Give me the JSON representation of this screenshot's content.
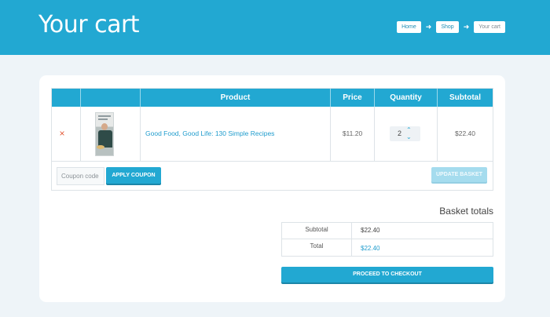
{
  "header": {
    "title": "Your cart",
    "breadcrumb": [
      "Home",
      "Shop",
      "Your cart"
    ]
  },
  "cart": {
    "columns": [
      "",
      "",
      "Product",
      "Price",
      "Quantity",
      "Subtotal"
    ],
    "items": [
      {
        "remove_icon": "close-icon",
        "remove_symbol": "×",
        "product": "Good Food, Good Life: 130 Simple Recipes",
        "price": "$11.20",
        "quantity": "2",
        "subtotal": "$22.40"
      }
    ],
    "quantity_up": "⌃",
    "quantity_down": "⌄",
    "coupon_placeholder": "Coupon code",
    "apply_coupon": "Apply coupon",
    "update_basket": "Update basket"
  },
  "totals": {
    "title": "Basket totals",
    "subtotal_label": "Subtotal",
    "subtotal_value": "$22.40",
    "total_label": "Total",
    "total_value": "$22.40",
    "checkout": "Proceed to checkout"
  },
  "colors": {
    "accent": "#22a8d2",
    "link": "#1f9ccd",
    "remove": "#e35b3a",
    "page_background": "#eef4f8"
  }
}
